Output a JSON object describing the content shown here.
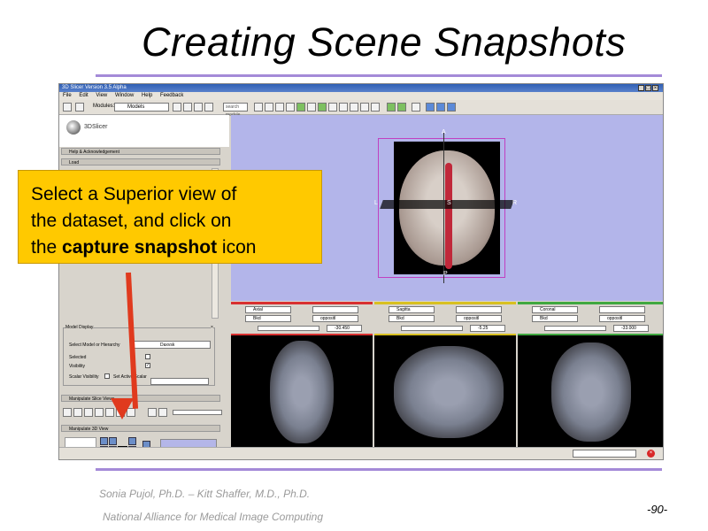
{
  "slide": {
    "title": "Creating Scene Snapshots",
    "footer_line1": "Sonia Pujol, Ph.D. – Kitt Shaffer, M.D., Ph.D.",
    "footer_line2": "National Alliance for Medical Image Computing",
    "page_number": "-90-"
  },
  "callout": {
    "line1": "Select a Superior view of",
    "line2": "the dataset, and click on",
    "prefix3": "the ",
    "bold3": "capture snapshot",
    "suffix3": " icon"
  },
  "app": {
    "window_title": "3D Slicer Version 3.5 Alpha",
    "menu": [
      "File",
      "Edit",
      "View",
      "Window",
      "Help",
      "Feedback"
    ],
    "modules_label": "Modules:",
    "modules_selected": "Models",
    "search_placeholder": "search module",
    "logo_text": "3DSlicer",
    "sections": {
      "help": "Help & Acknowledgement",
      "load": "Load",
      "model_display": "Model Display",
      "slice_views": "Manipulate Slice Views",
      "view_3d": "Manipulate 3D View"
    },
    "model_display": {
      "select_label": "Select Model or Hierarchy",
      "selected_model": "Daxvsk",
      "selected_label": "Selected",
      "visibility_label": "Visibility",
      "scalar_label": "Scalar Visibility",
      "active_scalar_label": "Set Active Scalar"
    },
    "view_axes": {
      "anterior": "A",
      "left": "L",
      "right": "R",
      "superior": "S",
      "posterior": "P"
    },
    "slices": [
      {
        "name": "Axial",
        "fg": "Axial",
        "layer": "Bkd",
        "fit": "oppositl",
        "offset": "-30.450",
        "color": "#d83030"
      },
      {
        "name": "Sagittal",
        "fg": "Sagitta",
        "layer": "Bkd",
        "fit": "oppositl",
        "offset": "-5.25",
        "color": "#d8c020"
      },
      {
        "name": "Coronal",
        "fg": "Coronal",
        "layer": "Bkd",
        "fit": "oppositl",
        "offset": "-33.000",
        "color": "#40a840"
      }
    ],
    "colors": {
      "view_bg": "#b3b5ea",
      "vessel": "#c0283a",
      "callout": "#ffc900",
      "arrow": "#e03a1e",
      "rule": "#a48ad8"
    }
  }
}
